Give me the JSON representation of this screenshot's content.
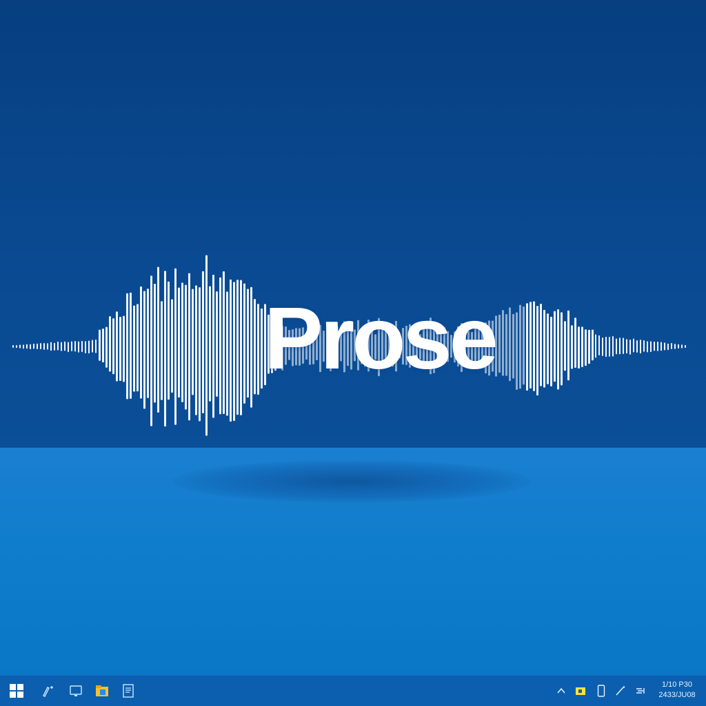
{
  "desktop": {
    "logo": {
      "text": "Prose",
      "text_color": "#ffffff",
      "wave_color": "#ffffff"
    },
    "colors": {
      "sky": "#0a4a92",
      "floor": "#0f7dcb",
      "taskbar": "#0b5fae"
    }
  },
  "taskbar": {
    "start_icon": "windows-start-icon",
    "pinned": [
      {
        "name": "pen-app-icon"
      },
      {
        "name": "tablet-app-icon"
      },
      {
        "name": "file-explorer-icon"
      },
      {
        "name": "document-icon"
      }
    ],
    "tray": [
      {
        "name": "chevron-up-icon"
      },
      {
        "name": "folder-tray-icon"
      },
      {
        "name": "phone-icon"
      },
      {
        "name": "pen-tray-icon"
      },
      {
        "name": "network-icon"
      }
    ],
    "clock": {
      "time": "1/10 P30",
      "date": "2433/JU08"
    }
  }
}
